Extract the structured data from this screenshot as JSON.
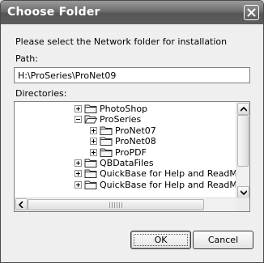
{
  "window": {
    "title": "Choose Folder"
  },
  "dialog": {
    "prompt": "Please select the Network folder for installation",
    "path_label": "Path:",
    "path_value": "H:\\ProSeries\\ProNet09",
    "directories_label": "Directories:",
    "tree": [
      {
        "label": "PhotoShop",
        "state": "collapsed",
        "depth": 0
      },
      {
        "label": "ProSeries",
        "state": "expanded",
        "depth": 0
      },
      {
        "label": "ProNet07",
        "state": "collapsed",
        "depth": 1
      },
      {
        "label": "ProNet08",
        "state": "collapsed",
        "depth": 1
      },
      {
        "label": "ProPDF",
        "state": "collapsed",
        "depth": 1
      },
      {
        "label": "QBDataFiles",
        "state": "collapsed",
        "depth": 0
      },
      {
        "label": "QuickBase for Help and ReadMe files",
        "state": "collapsed",
        "depth": 0
      },
      {
        "label": "QuickBase for Help and ReadMe files",
        "state": "collapsed",
        "depth": 0
      }
    ],
    "buttons": {
      "ok": "OK",
      "cancel": "Cancel"
    }
  },
  "icons": {
    "close": "close-icon",
    "folder": "folder-icon",
    "folder_open": "folder-open-icon",
    "expander_plus": "plus-expander-icon",
    "expander_minus": "minus-expander-icon",
    "scroll_up": "arrow-up-icon",
    "scroll_down": "arrow-down-icon",
    "scroll_left": "arrow-left-icon",
    "scroll_right": "arrow-right-icon"
  },
  "colors": {
    "title_bar": "#5e5e5e",
    "dialog_bg": "#efefef",
    "field_bg": "#ffffff"
  }
}
